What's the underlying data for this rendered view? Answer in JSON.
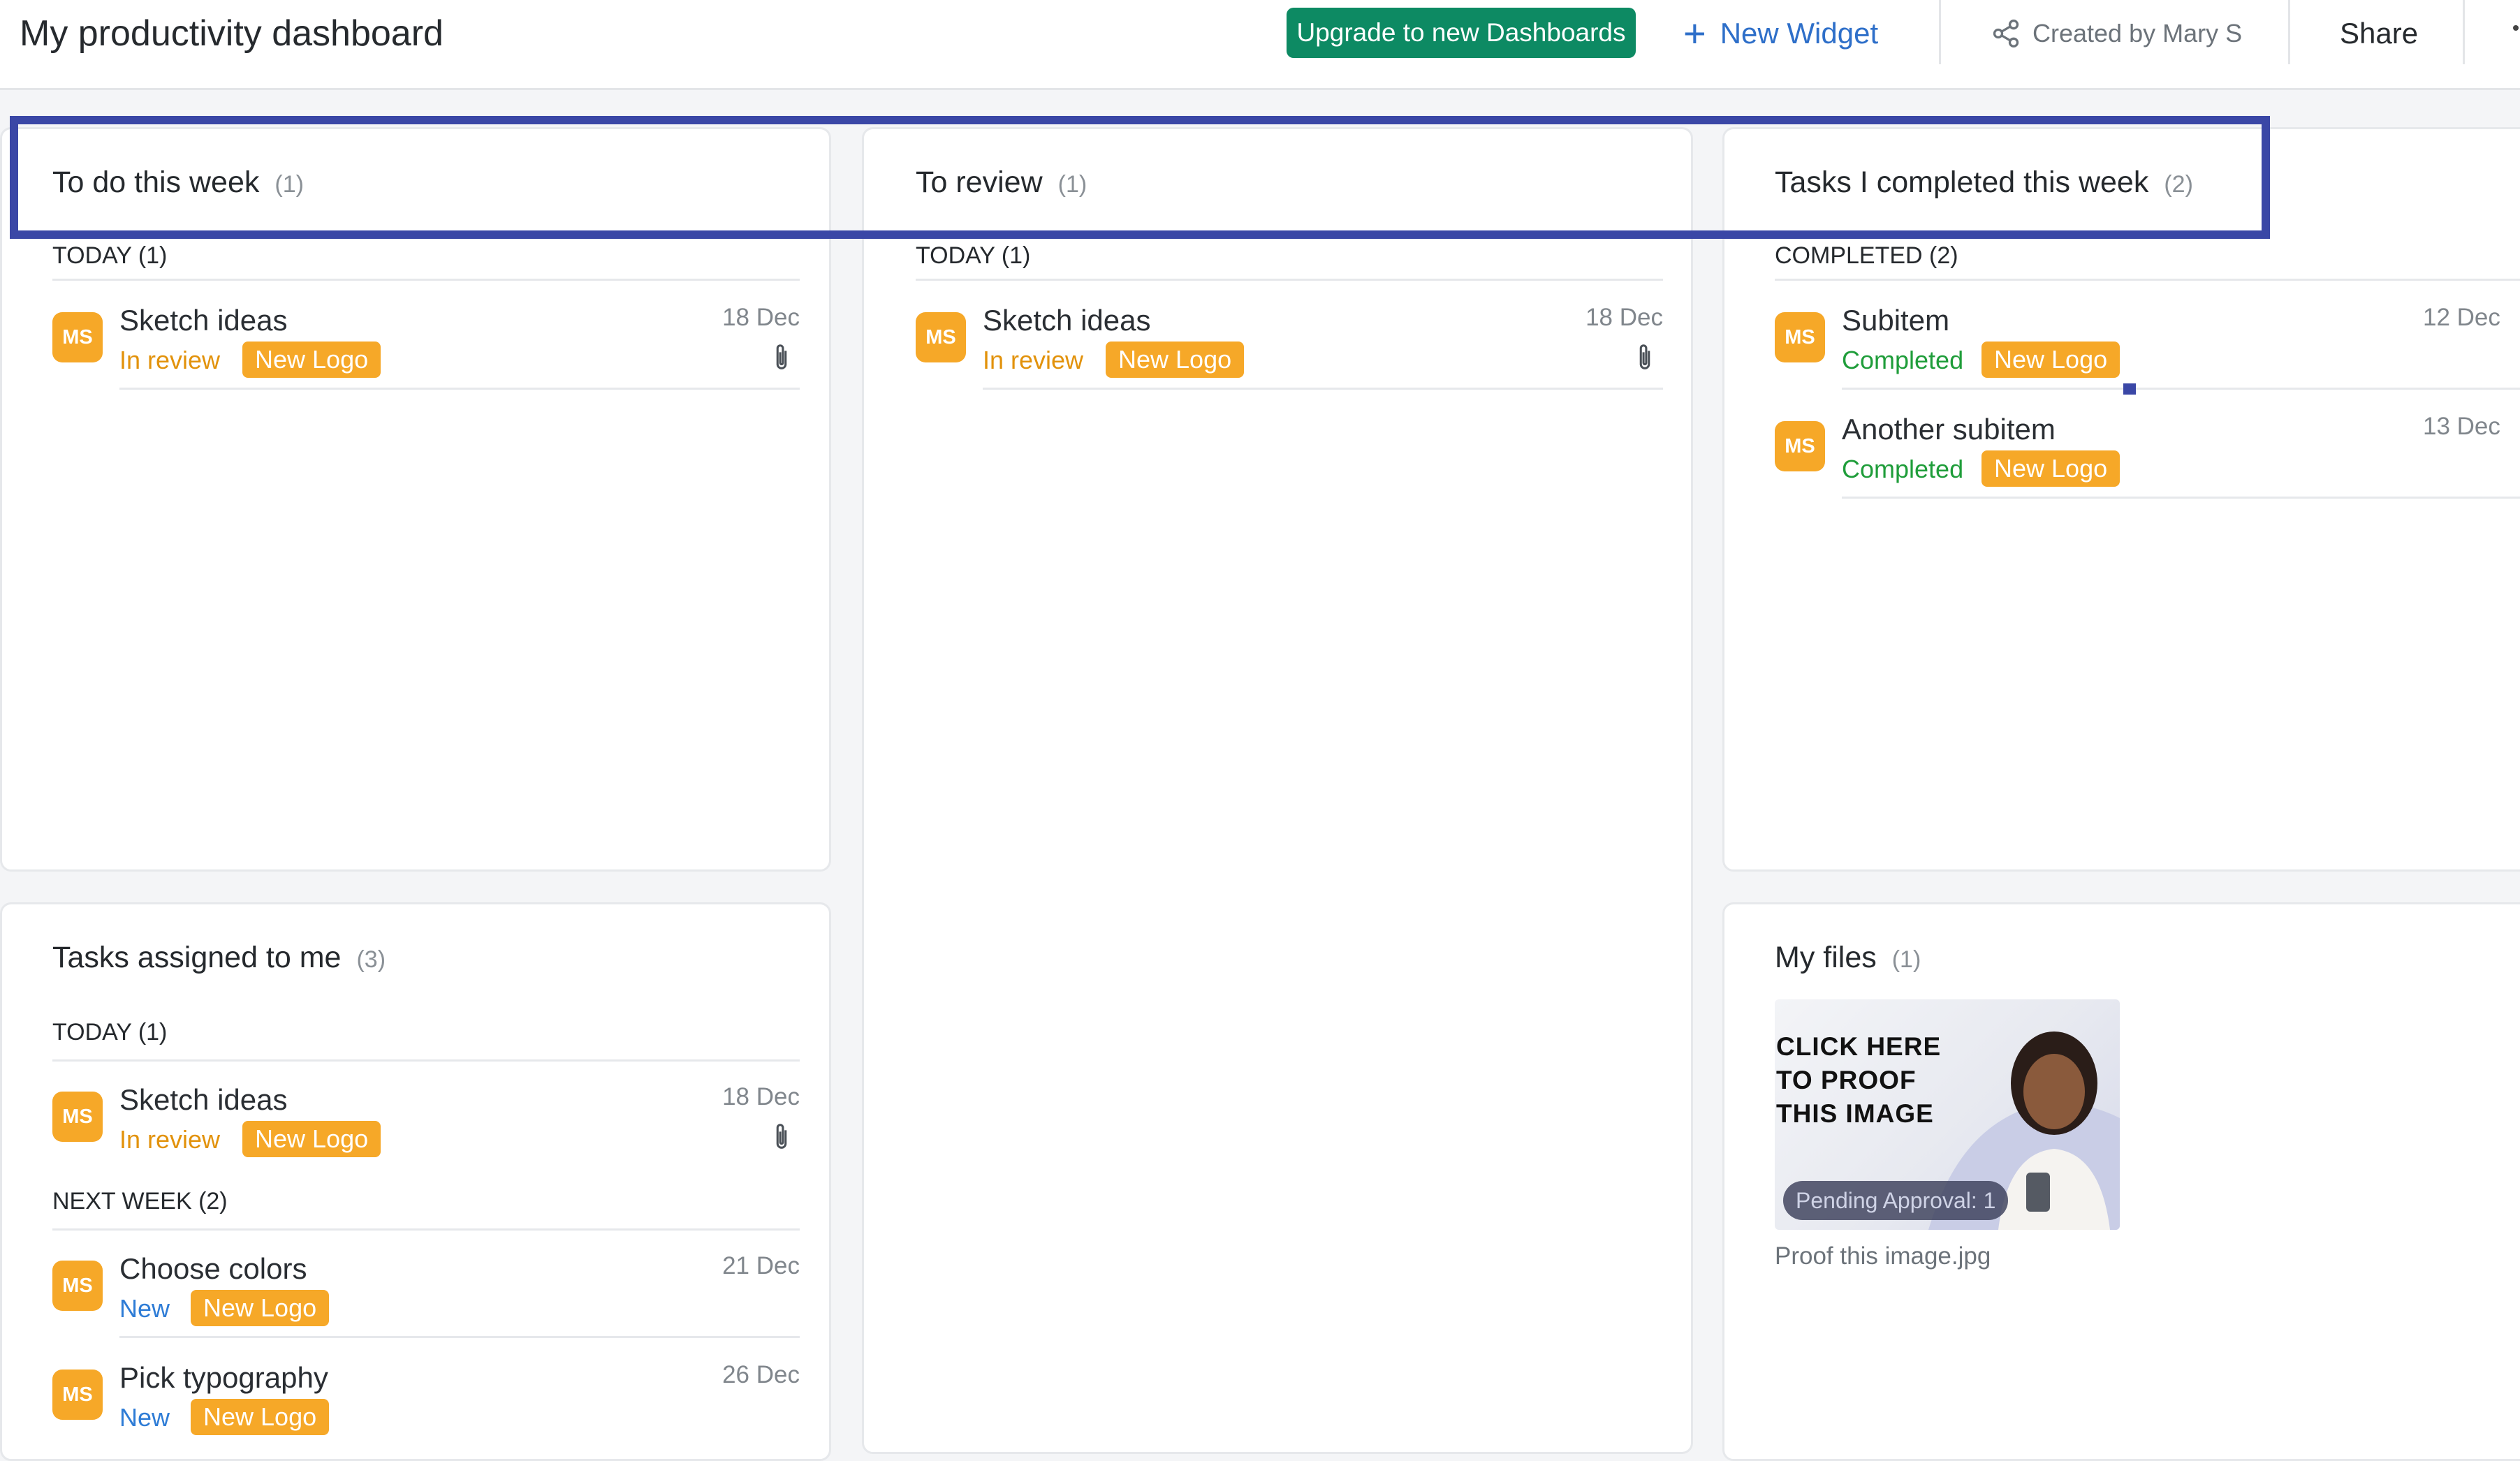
{
  "header": {
    "title": "My productivity dashboard",
    "upgrade_label": "Upgrade to new Dashboards",
    "new_widget_label": "New Widget",
    "created_by": "Created by Mary S",
    "share_label": "Share"
  },
  "colors": {
    "accent_blue": "#2e6fc9",
    "upgrade_green": "#0d8a63",
    "tag_orange": "#f6a828",
    "highlight": "#3a47a6",
    "status_review": "#e2920b",
    "status_completed": "#1f9d3a",
    "status_new": "#2e7cd6"
  },
  "widgets": {
    "todo": {
      "title": "To do this week",
      "count": "(1)",
      "section": "TODAY (1)",
      "tasks": [
        {
          "avatar": "MS",
          "name": "Sketch ideas",
          "status": "In review",
          "tag": "New Logo",
          "date": "18 Dec",
          "icon": "paperclip-icon"
        }
      ]
    },
    "review": {
      "title": "To review",
      "count": "(1)",
      "section": "TODAY (1)",
      "tasks": [
        {
          "avatar": "MS",
          "name": "Sketch ideas",
          "status": "In review",
          "tag": "New Logo",
          "date": "18 Dec",
          "icon": "paperclip-icon"
        }
      ]
    },
    "completed": {
      "title": "Tasks I completed this week",
      "count": "(2)",
      "section": "COMPLETED (2)",
      "tasks": [
        {
          "avatar": "MS",
          "name": "Subitem",
          "status": "Completed",
          "tag": "New Logo",
          "date": "12 Dec"
        },
        {
          "avatar": "MS",
          "name": "Another subitem",
          "status": "Completed",
          "tag": "New Logo",
          "date": "13 Dec"
        }
      ]
    },
    "assigned": {
      "title": "Tasks assigned to me",
      "count": "(3)",
      "section_today": "TODAY (1)",
      "section_next": "NEXT WEEK (2)",
      "tasks": [
        {
          "avatar": "MS",
          "name": "Sketch ideas",
          "status": "In review",
          "tag": "New Logo",
          "date": "18 Dec",
          "icon": "paperclip-icon"
        },
        {
          "avatar": "MS",
          "name": "Choose colors",
          "status": "New",
          "tag": "New Logo",
          "date": "21 Dec"
        },
        {
          "avatar": "MS",
          "name": "Pick typography",
          "status": "New",
          "tag": "New Logo",
          "date": "26 Dec"
        }
      ]
    },
    "files": {
      "title": "My files",
      "count": "(1)",
      "thumb_text": [
        "CLICK HERE",
        "TO PROOF",
        "THIS IMAGE"
      ],
      "pending": "Pending Approval: 1",
      "file_name": "Proof this image.jpg"
    }
  }
}
